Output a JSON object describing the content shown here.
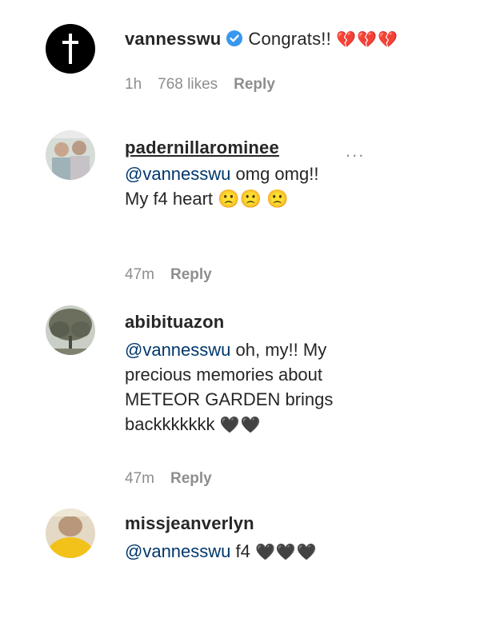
{
  "comments": [
    {
      "username": "vannesswu",
      "verified": true,
      "text": "Congrats!! ",
      "emoji": "💔💔💔",
      "time": "1h",
      "likes": "768 likes",
      "reply": "Reply"
    },
    {
      "username": "padernillarominee",
      "mention": "@vannesswu",
      "text": " omg omg!! My f4 heart ",
      "emoji": "🙁🙁 🙁",
      "time": "47m",
      "reply": "Reply",
      "more": "..."
    },
    {
      "username": "abibituazon",
      "mention": "@vannesswu",
      "text": " oh, my!! My precious memories about METEOR GARDEN brings backkkkkkk ",
      "emoji": "🖤🖤",
      "time": "47m",
      "reply": "Reply"
    },
    {
      "username": "missjeanverlyn",
      "mention": "@vannesswu",
      "text": " f4 ",
      "emoji": "🖤🖤🖤"
    }
  ]
}
